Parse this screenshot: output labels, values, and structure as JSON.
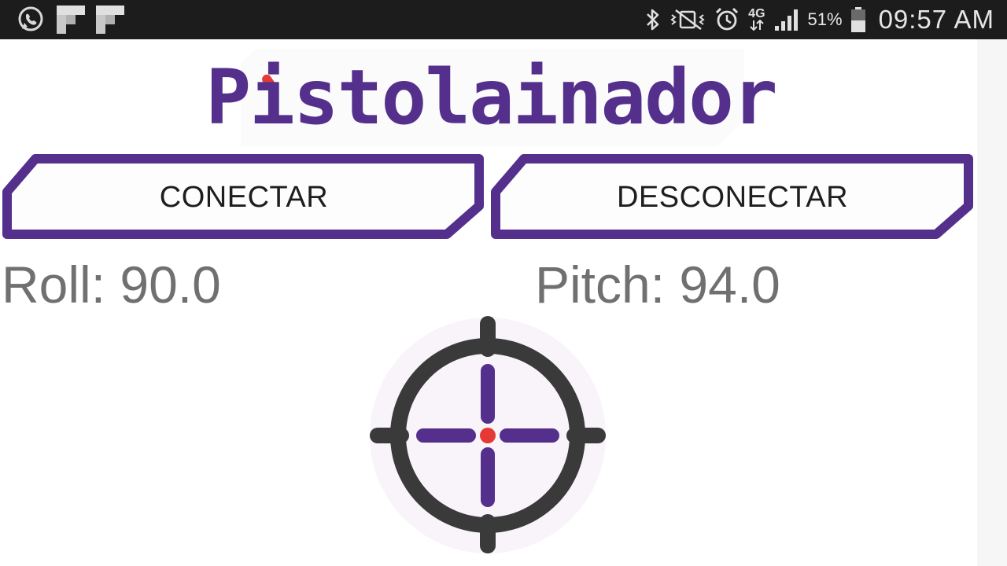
{
  "status_bar": {
    "notification_icons": [
      "whatsapp-icon",
      "flipboard-icon",
      "flipboard-icon"
    ],
    "system_icons": [
      "bluetooth-icon",
      "vibrate-icon",
      "alarm-icon",
      "network-4g-icon",
      "signal-icon",
      "battery-icon"
    ],
    "network_label": "4G",
    "battery_percent": "51%",
    "battery_level": 0.51,
    "time": "09:57 AM"
  },
  "logo": {
    "text": "Pistolainador",
    "accent_color": "#e53935",
    "brand_color": "#54308c"
  },
  "buttons": {
    "connect_label": "CONECTAR",
    "disconnect_label": "DESCONECTAR"
  },
  "readouts": {
    "roll_label": "Roll:",
    "roll_value": "90.0",
    "pitch_label": "Pitch:",
    "pitch_value": "94.0"
  },
  "crosshair": {
    "icon": "crosshair-icon",
    "ring_color": "#3a3a3a",
    "cross_color": "#54308c",
    "center_color": "#e53935",
    "background_color": "#f8f4fa"
  }
}
